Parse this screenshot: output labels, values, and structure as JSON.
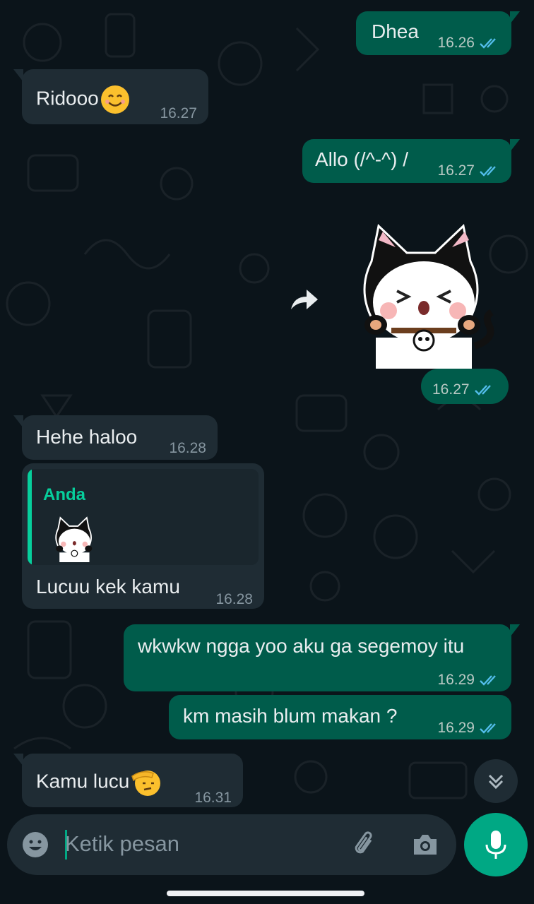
{
  "composer": {
    "placeholder": "Ketik pesan"
  },
  "reply": {
    "sender": "Anda"
  },
  "messages": [
    {
      "text": "Dhea",
      "time": "16.26",
      "direction": "out"
    },
    {
      "text": "Ridooo",
      "emoji": "smiling-face",
      "time": "16.27",
      "direction": "in"
    },
    {
      "text": "Allo (/^-^) /",
      "time": "16.27",
      "direction": "out"
    },
    {
      "sticker": "cat-in-black-hood-sticker",
      "time": "16.27",
      "direction": "out"
    },
    {
      "text": "Hehe haloo",
      "time": "16.28",
      "direction": "in"
    },
    {
      "text": "Lucuu kek kamu",
      "time": "16.28",
      "direction": "in"
    },
    {
      "text": "wkwkw ngga yoo aku ga segemoy itu",
      "time": "16.29",
      "direction": "out"
    },
    {
      "text": "km masih blum makan ?",
      "time": "16.29",
      "direction": "out"
    },
    {
      "text": "Kamu lucu",
      "emoji": "saluting-face",
      "time": "16.31",
      "direction": "in"
    }
  ],
  "colors": {
    "background": "#0b141a",
    "incoming_bubble": "#1f2c34",
    "outgoing_bubble": "#005c4b",
    "accent": "#00a884",
    "read_ticks": "#53bdeb"
  }
}
